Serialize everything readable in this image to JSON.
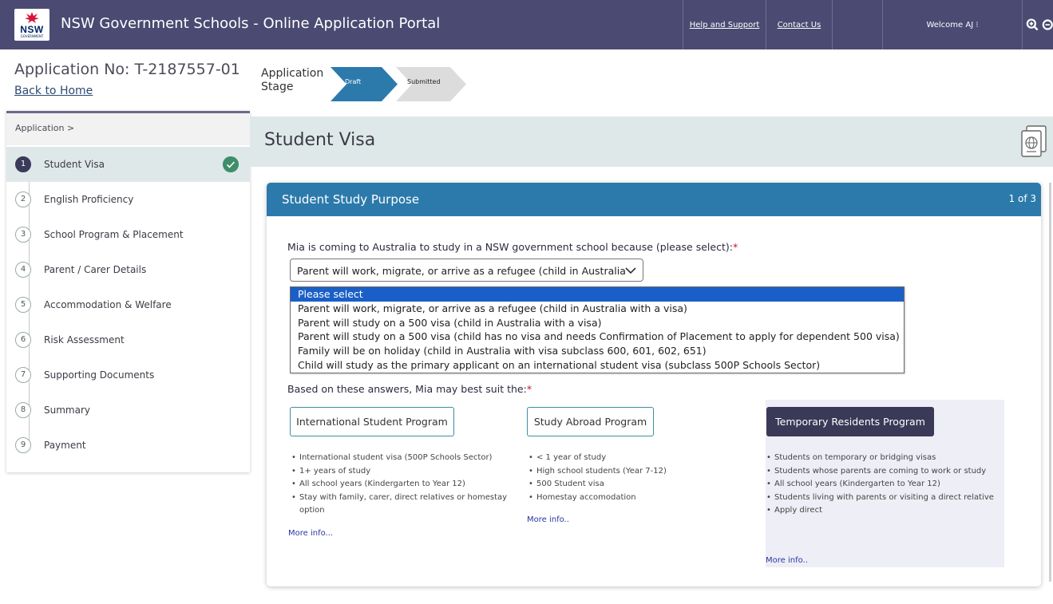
{
  "header": {
    "logo_text": "NSW",
    "logo_subtext": "GOVERNMENT",
    "title": "NSW Government Schools - Online Application Portal",
    "nav": {
      "help": "Help and Support",
      "contact": "Contact Us",
      "welcome": "Welcome AJ ⁝"
    },
    "zoom_in_icon": "zoom-in-icon",
    "zoom_out_icon": "zoom-out-icon"
  },
  "application": {
    "number": "Application No: T-2187557-01",
    "back_link": "Back to Home",
    "stage_label": "Application Stage",
    "stages": [
      "Draft",
      "Submitted"
    ]
  },
  "sidebar": {
    "breadcrumb": "Application >",
    "steps": [
      {
        "num": "1",
        "label": "Student Visa",
        "active": true,
        "complete": true
      },
      {
        "num": "2",
        "label": "English Proficiency"
      },
      {
        "num": "3",
        "label": "School Program & Placement"
      },
      {
        "num": "4",
        "label": "Parent / Carer Details"
      },
      {
        "num": "5",
        "label": "Accommodation & Welfare"
      },
      {
        "num": "6",
        "label": "Risk Assessment"
      },
      {
        "num": "7",
        "label": "Supporting Documents"
      },
      {
        "num": "8",
        "label": "Summary"
      },
      {
        "num": "9",
        "label": "Payment"
      }
    ]
  },
  "main": {
    "page_title": "Student Visa",
    "page_icon": "passport-icon",
    "panel": {
      "title": "Student Study Purpose",
      "count": "1 of 3",
      "question": "Mia is coming to Australia to study in a NSW government school because (please select):",
      "required_mark": "*",
      "select_value": "Parent will work, migrate, or arrive as a refugee (child in Australia",
      "options": [
        "Please select",
        "Parent will work, migrate, or arrive as a refugee (child in Australia with a visa)",
        "Parent will study on a 500 visa (child in Australia with a visa)",
        "Parent will study on a 500 visa (child has no visa and needs Confirmation of Placement to apply for dependent 500 visa)",
        "Family will be on holiday (child in Australia with visa subclass 600, 601, 602, 651)",
        "Child will study as the primary applicant on an international student visa (subclass 500P Schools Sector)"
      ],
      "suit_label": "Based on these answers, Mia may best suit the:",
      "programs": [
        {
          "name": "International Student Program",
          "bullets": [
            "International student visa (500P Schools Sector)",
            "1+ years of study",
            "All school years (Kindergarten to Year 12)",
            "Stay with family, carer, direct relatives or homestay option"
          ],
          "more": "More info..."
        },
        {
          "name": "Study Abroad Program",
          "bullets": [
            "< 1 year of study",
            "High school students (Year 7-12)",
            "500 Student visa",
            "Homestay accomodation"
          ],
          "more": "More info.."
        },
        {
          "name": "Temporary Residents Program",
          "bullets": [
            "Students on temporary or bridging visas",
            "Students whose parents are coming to work or study",
            "All school years (Kindergarten to Year 12)",
            "Students living with parents or visiting a direct relative",
            "Apply direct"
          ],
          "more": "More info.."
        }
      ]
    }
  },
  "colors": {
    "header_bg": "#4b4a72",
    "panel_head": "#2c7aab",
    "stage_active": "#2c7aab",
    "dropdown_highlight": "#1a5fc7",
    "check_green": "#3e8e6b",
    "program_dark": "#3a3957"
  }
}
